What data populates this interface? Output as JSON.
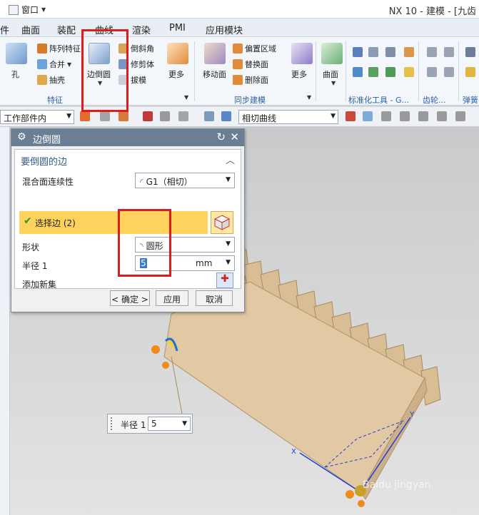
{
  "titlebar": {
    "window_menu": "窗口",
    "app_title": "NX 10 - 建模 - [九齿"
  },
  "menu": [
    "曲面",
    "装配",
    "曲线",
    "渲染",
    "PMI",
    "应用模块"
  ],
  "ribbon": {
    "feature": {
      "hole": "孔",
      "array": "阵列特征",
      "unite": "合并",
      "shell": "抽壳",
      "edge_blend": "边倒圆",
      "chamfer": "倒斜角",
      "trim_body": "修剪体",
      "draft": "拔模",
      "more": "更多",
      "group": "特征"
    },
    "sync": {
      "move_face": "移动面",
      "offset_region": "偏置区域",
      "replace_face": "替换面",
      "delete_face": "删除面",
      "more": "更多",
      "group": "同步建模"
    },
    "surface": {
      "surface": "曲面"
    },
    "std": {
      "group": "标准化工具 - G..."
    },
    "gear": {
      "group": "齿轮..."
    },
    "spring": {
      "group": "弹簧..."
    }
  },
  "toolbar2": {
    "scope": "工作部件内",
    "curve_rule": "相切曲线"
  },
  "dialog": {
    "title": "边倒圆",
    "section": "要倒圆的边",
    "continuity_label": "混合面连续性",
    "continuity_value": "G1（相切）",
    "select_edge": "选择边 (2)",
    "shape_label": "形状",
    "shape_value": "圆形",
    "radius_label": "半径 1",
    "radius_value": "5",
    "radius_unit": "mm",
    "add_set": "添加新集",
    "ok": "< 确定 >",
    "apply": "应用",
    "cancel": "取消"
  },
  "callout": {
    "label": "半径 1",
    "value": "5"
  },
  "axes": {
    "x": "X",
    "y": "Y"
  },
  "watermark": "Baidu jingyan"
}
